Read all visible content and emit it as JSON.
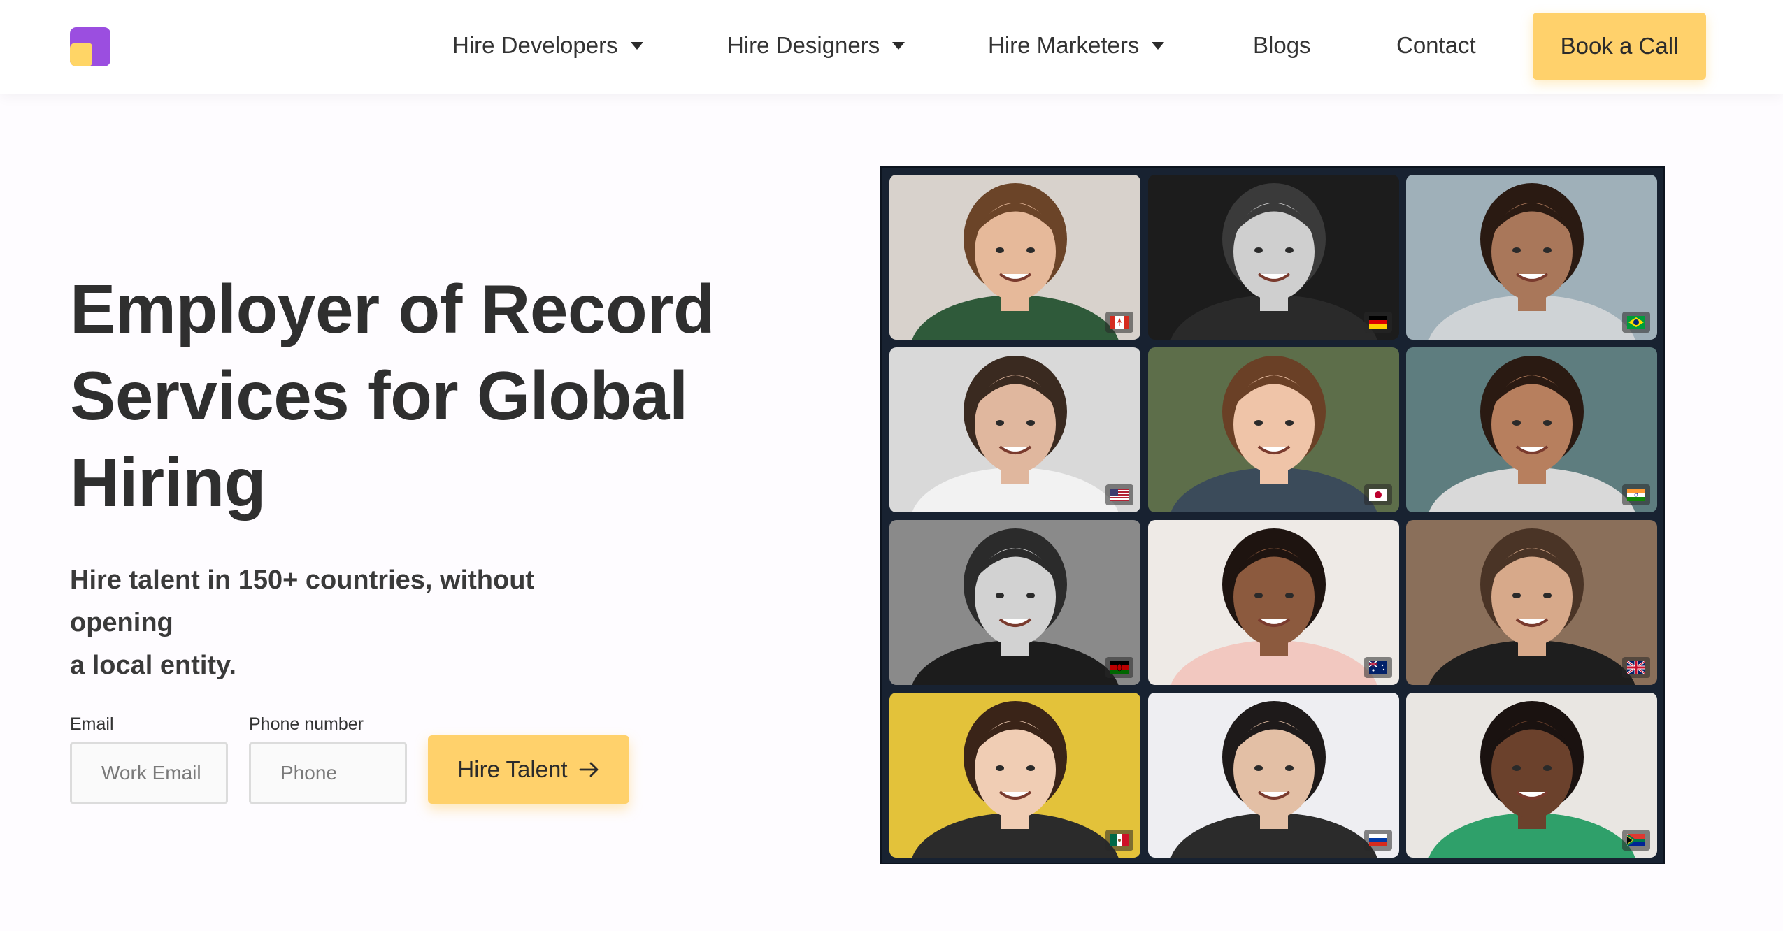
{
  "nav": {
    "items": [
      {
        "label": "Hire Developers",
        "dropdown": true
      },
      {
        "label": "Hire Designers",
        "dropdown": true
      },
      {
        "label": "Hire Marketers",
        "dropdown": true
      },
      {
        "label": "Blogs",
        "dropdown": false
      },
      {
        "label": "Contact",
        "dropdown": false
      }
    ],
    "cta_label": "Book a Call"
  },
  "hero": {
    "title_line1": "Employer of Record",
    "title_line2": "Services for Global",
    "title_line3": "Hiring",
    "subtitle_line1": "Hire talent in 150+ countries, without opening",
    "subtitle_line2": "a local entity."
  },
  "form": {
    "email_label": "Email",
    "email_placeholder": "Work Email",
    "phone_label": "Phone number",
    "phone_placeholder": "Phone",
    "submit_label": "Hire Talent"
  },
  "colors": {
    "accent": "#ffd16b",
    "logo_purple": "#9b4ee0",
    "logo_yellow": "#ffd566",
    "grid_bg": "#182231"
  },
  "talent_grid": [
    {
      "flag": "canada",
      "bg": "#d8d2cc",
      "skin": "#e6b99a",
      "hair": "#6b4428",
      "shirt": "#2f5a3a"
    },
    {
      "flag": "germany",
      "bg": "#1c1c1c",
      "skin": "#cfcfcf",
      "hair": "#3a3a3a",
      "shirt": "#2a2a2a"
    },
    {
      "flag": "brazil",
      "bg": "#9fb0b9",
      "skin": "#a9775a",
      "hair": "#2a1a12",
      "shirt": "#cfd3d6"
    },
    {
      "flag": "usa",
      "bg": "#d9d9d9",
      "skin": "#e0b79e",
      "hair": "#3a2a20",
      "shirt": "#f2f2f2"
    },
    {
      "flag": "japan",
      "bg": "#5d6e4a",
      "skin": "#efc4a8",
      "hair": "#6a4026",
      "shirt": "#3b4b5a"
    },
    {
      "flag": "india",
      "bg": "#5e7d7f",
      "skin": "#b77f5e",
      "hair": "#2a1a12",
      "shirt": "#d9d9d9"
    },
    {
      "flag": "kenya",
      "bg": "#8a8a8a",
      "skin": "#d2d2d2",
      "hair": "#2b2b2b",
      "shirt": "#1c1c1c"
    },
    {
      "flag": "australia",
      "bg": "#eeeae6",
      "skin": "#8c5a3e",
      "hair": "#1e1410",
      "shirt": "#f2c8c0"
    },
    {
      "flag": "uk",
      "bg": "#8a6f5a",
      "skin": "#d7a98a",
      "hair": "#4a3426",
      "shirt": "#1e1e1e"
    },
    {
      "flag": "mexico",
      "bg": "#e3c23a",
      "skin": "#f0cdb4",
      "hair": "#3a2418",
      "shirt": "#2b2b2b"
    },
    {
      "flag": "russia",
      "bg": "#eeeef2",
      "skin": "#e3bfa5",
      "hair": "#1e1a1a",
      "shirt": "#2b2b2b"
    },
    {
      "flag": "south-africa",
      "bg": "#e9e6e2",
      "skin": "#6b412c",
      "hair": "#1a1210",
      "shirt": "#2fa06a"
    }
  ]
}
